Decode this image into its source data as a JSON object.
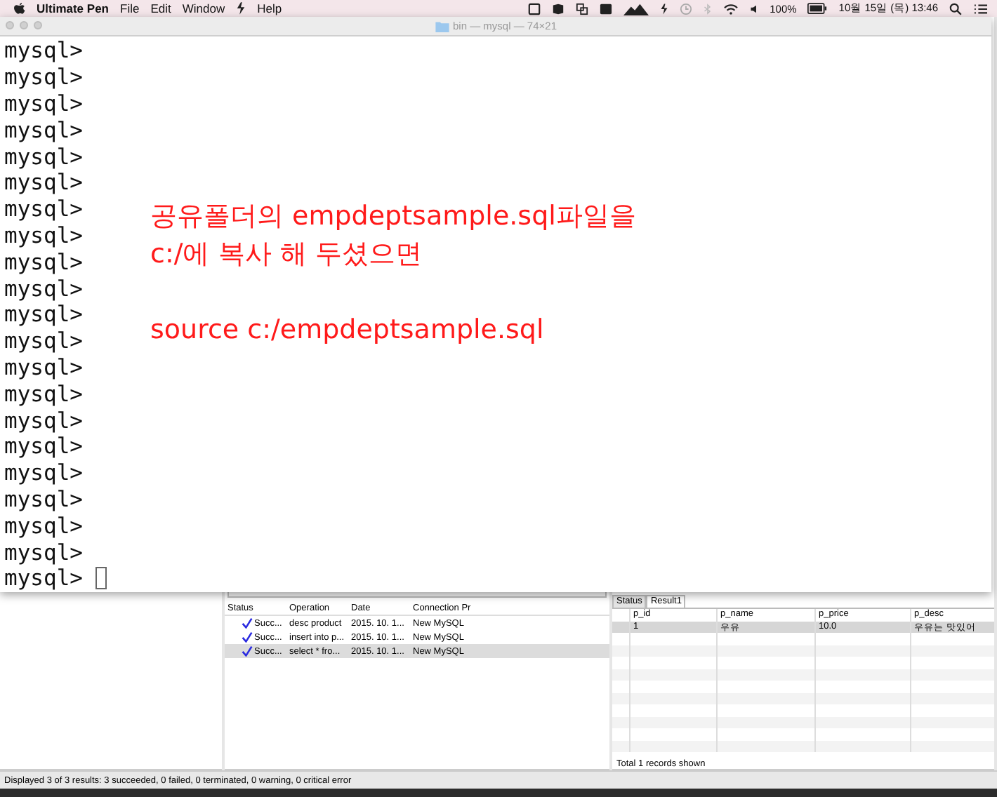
{
  "menu_bar": {
    "app_name": "Ultimate Pen",
    "menus": [
      "File",
      "Edit",
      "Window",
      "Help"
    ],
    "battery": "100%",
    "clock": "10월 15일 (목) 13:46"
  },
  "terminal": {
    "title": "bin — mysql — 74×21",
    "lines": [
      "mysql>",
      "mysql>",
      "mysql>",
      "mysql>",
      "mysql>",
      "mysql>",
      "mysql>",
      "mysql>",
      "mysql>",
      "mysql>",
      "mysql>",
      "mysql>",
      "mysql>",
      "mysql>",
      "mysql>",
      "mysql>",
      "mysql>",
      "mysql>",
      "mysql>",
      "mysql>",
      "mysql>"
    ],
    "annotation": [
      "공유폴더의 empdeptsample.sql파일을",
      "c:/에 복사 해 두셨으면",
      "source c:/empdeptsample.sql"
    ]
  },
  "history": {
    "columns": [
      "Status",
      "Operation",
      "Date",
      "Connection Pr"
    ],
    "rows": [
      {
        "cells": [
          "Succ...",
          "desc product",
          "2015. 10. 1...",
          "New MySQL"
        ],
        "selected": false
      },
      {
        "cells": [
          "Succ...",
          "insert into p...",
          "2015. 10. 1...",
          "New MySQL"
        ],
        "selected": false
      },
      {
        "cells": [
          "Succ...",
          "select * fro...",
          "2015. 10. 1...",
          "New MySQL"
        ],
        "selected": true
      }
    ]
  },
  "result": {
    "tabs": [
      {
        "label": "Status",
        "selected": false
      },
      {
        "label": "Result1",
        "selected": true
      }
    ],
    "columns": [
      "p_id",
      "p_name",
      "p_price",
      "p_desc"
    ],
    "rows": [
      {
        "cells": [
          "1",
          "우유",
          "10.0",
          "우유는 맛있어"
        ],
        "selected": true
      }
    ],
    "footer": "Total 1 records shown"
  },
  "status_bar": "Displayed 3 of 3 results: 3 succeeded, 0 failed, 0 terminated, 0 warning, 0 critical error"
}
